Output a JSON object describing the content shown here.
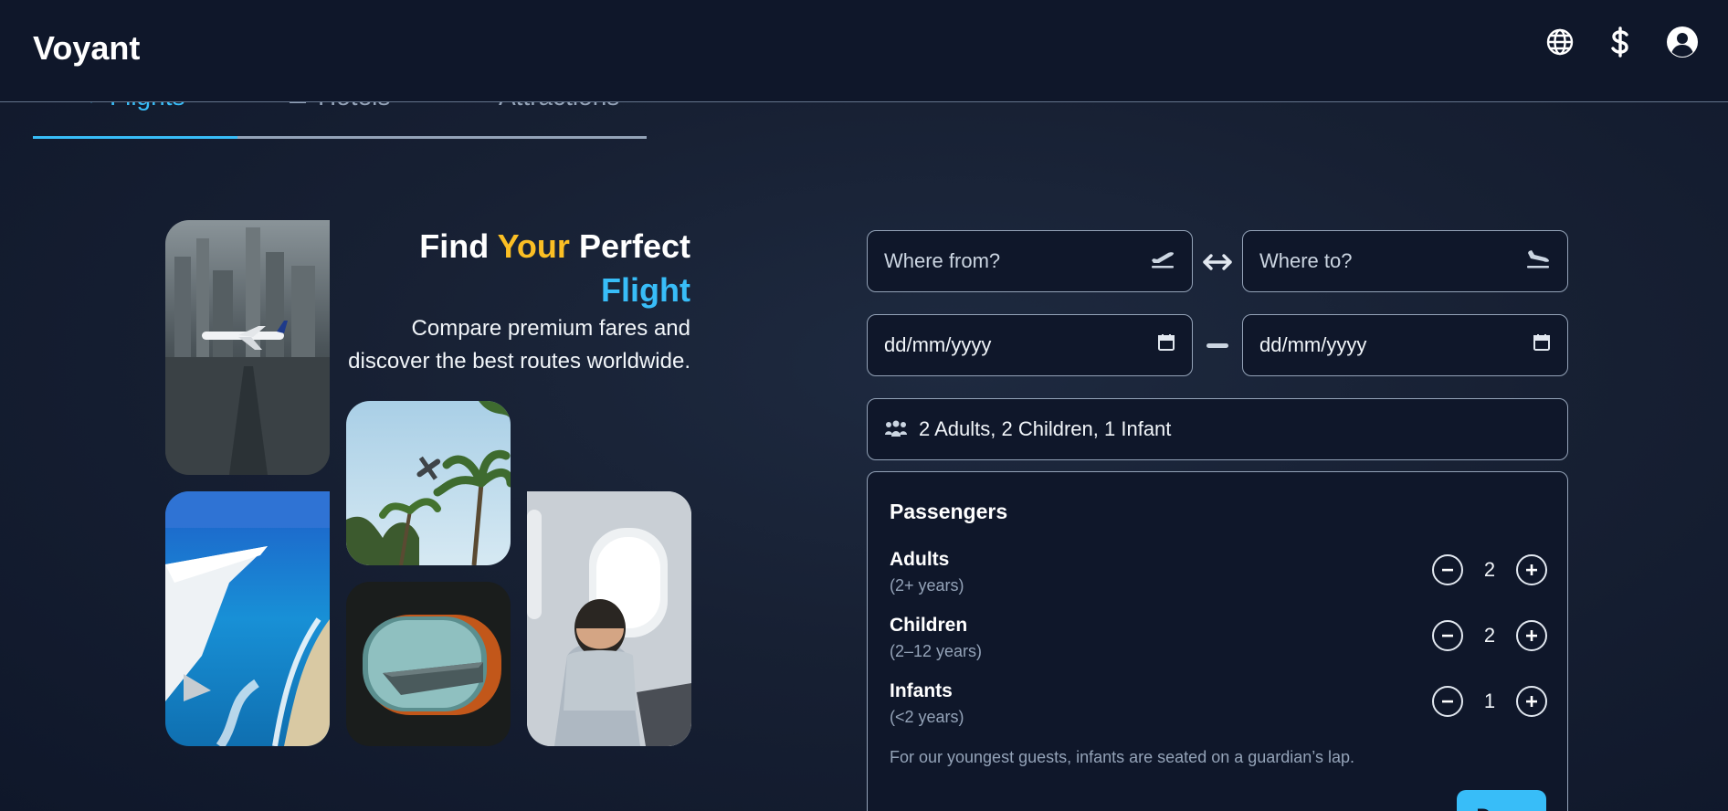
{
  "header": {
    "brand": "Voyant",
    "icons": [
      "globe-icon",
      "dollar-icon",
      "user-circle-icon"
    ]
  },
  "tabs": [
    {
      "label": "Flights",
      "icon": "plane-icon",
      "active": true
    },
    {
      "label": "Hotels",
      "icon": "hotel-icon",
      "active": false
    },
    {
      "label": "Attractions",
      "icon": "attractions-icon",
      "active": false
    }
  ],
  "hero": {
    "title_part1": "Find",
    "title_highlight": "Your",
    "title_part2": "Perfect",
    "title_line2": "Flight",
    "subtitle_line1": "Compare premium fares and",
    "subtitle_line2": "discover the best routes worldwide."
  },
  "search": {
    "from_placeholder": "Where from?",
    "to_placeholder": "Where to?",
    "depart_date": "dd/mm/yyyy",
    "return_date": "dd/mm/yyyy",
    "passengers_summary": "2 Adults, 2 Children, 1 Infant"
  },
  "passengers": {
    "title": "Passengers",
    "rows": [
      {
        "name": "Adults",
        "age": "(2+ years)",
        "count": "2"
      },
      {
        "name": "Children",
        "age": "(2–12 years)",
        "count": "2"
      },
      {
        "name": "Infants",
        "age": "(<2 years)",
        "count": "1"
      }
    ],
    "note": "For our youngest guests, infants are seated on a guardian’s lap.",
    "done_label": "Done"
  },
  "colors": {
    "accent": "#38bdf8",
    "highlight": "#fbbf24",
    "background": "#0f172a"
  }
}
